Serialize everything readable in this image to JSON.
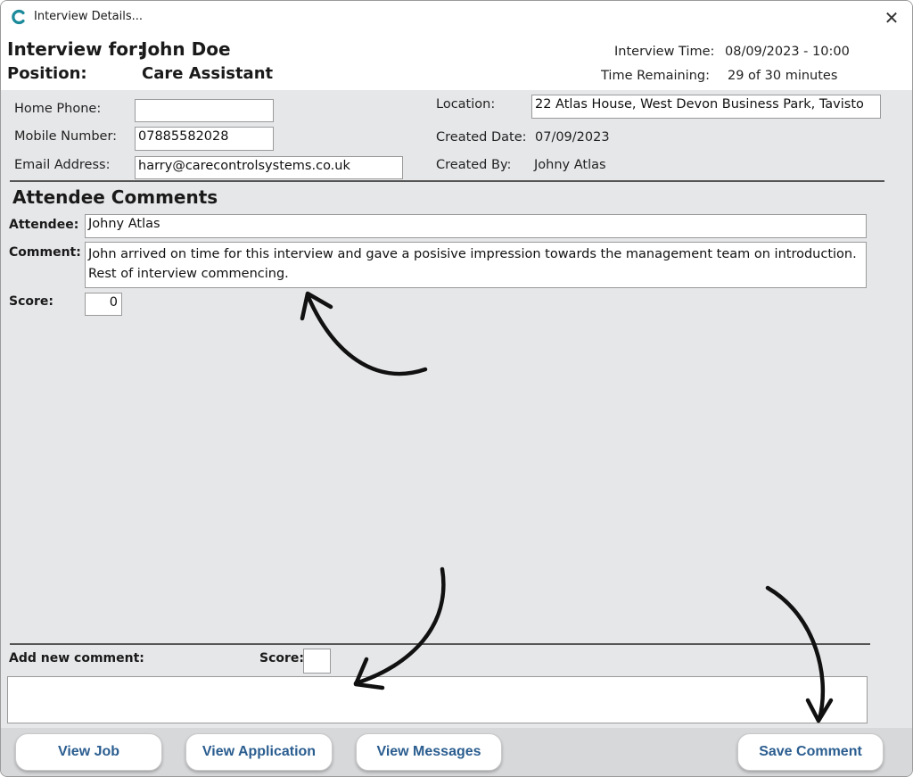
{
  "window": {
    "title": "Interview Details...",
    "app_icon": "care-control-logo-icon",
    "close_icon": "close-icon",
    "close_glyph": "✕"
  },
  "header": {
    "interview_for_label": "Interview for:",
    "candidate_name": "John Doe",
    "position_label": "Position:",
    "position_value": "Care Assistant",
    "interview_time_label": "Interview Time:",
    "interview_time_value": "08/09/2023 - 10:00",
    "time_remaining_label": "Time Remaining:",
    "time_remaining_value": "29 of 30 minutes"
  },
  "contact": {
    "home_phone_label": "Home Phone:",
    "home_phone_value": "",
    "mobile_label": "Mobile Number:",
    "mobile_value": "07885582028",
    "email_label": "Email Address:",
    "email_value": "harry@carecontrolsystems.co.uk",
    "location_label": "Location:",
    "location_value": "22 Atlas House, West Devon Business Park, Tavisto",
    "created_date_label": "Created Date:",
    "created_date_value": "07/09/2023",
    "created_by_label": "Created By:",
    "created_by_value": "Johny Atlas"
  },
  "attendee_comments": {
    "heading": "Attendee Comments",
    "attendee_label": "Attendee:",
    "attendee_value": "Johny Atlas",
    "comment_label": "Comment:",
    "comment_value": "John arrived on time for this interview and gave a posisive impression towards the management team on introduction. Rest of interview commencing.",
    "score_label": "Score:",
    "score_value": "0"
  },
  "new_comment": {
    "label": "Add new comment:",
    "score_label": "Score:",
    "score_value": "",
    "comment_value": ""
  },
  "buttons": {
    "view_job": "View Job",
    "view_application": "View Application",
    "view_messages": "View Messages",
    "save_comment": "Save Comment"
  },
  "colors": {
    "panel_bg": "#e6e7e9",
    "button_text": "#2a5d8f",
    "logo": "#1b8a9a",
    "annotation": "#111111"
  }
}
